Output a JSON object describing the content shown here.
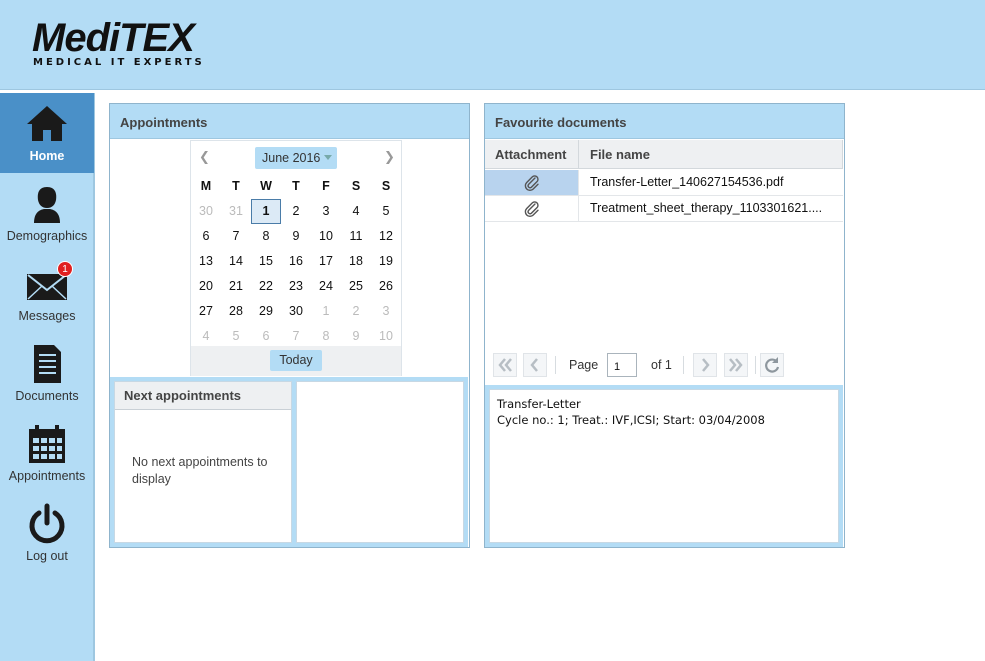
{
  "logo": {
    "main_prefix": "Med",
    "main_it": "iTEX",
    "subtitle": "MEDICAL IT EXPERTS"
  },
  "sidebar": {
    "items": [
      {
        "label": "Home",
        "icon": "home-icon",
        "active": true
      },
      {
        "label": "Demographics",
        "icon": "person-icon"
      },
      {
        "label": "Messages",
        "icon": "envelope-icon",
        "badge": "1"
      },
      {
        "label": "Documents",
        "icon": "document-icon"
      },
      {
        "label": "Appointments",
        "icon": "calendar-icon"
      },
      {
        "label": "Log out",
        "icon": "power-icon"
      }
    ]
  },
  "appointments": {
    "title": "Appointments",
    "calendar": {
      "month_label": "June 2016",
      "prev": "❮",
      "next": "❯",
      "weekdays": [
        "M",
        "T",
        "W",
        "T",
        "F",
        "S",
        "S"
      ],
      "weeks": [
        [
          {
            "d": "30",
            "o": true
          },
          {
            "d": "31",
            "o": true
          },
          {
            "d": "1",
            "s": true
          },
          {
            "d": "2"
          },
          {
            "d": "3"
          },
          {
            "d": "4"
          },
          {
            "d": "5"
          }
        ],
        [
          {
            "d": "6"
          },
          {
            "d": "7"
          },
          {
            "d": "8"
          },
          {
            "d": "9"
          },
          {
            "d": "10"
          },
          {
            "d": "11"
          },
          {
            "d": "12"
          }
        ],
        [
          {
            "d": "13"
          },
          {
            "d": "14"
          },
          {
            "d": "15"
          },
          {
            "d": "16"
          },
          {
            "d": "17"
          },
          {
            "d": "18"
          },
          {
            "d": "19"
          }
        ],
        [
          {
            "d": "20"
          },
          {
            "d": "21"
          },
          {
            "d": "22"
          },
          {
            "d": "23"
          },
          {
            "d": "24"
          },
          {
            "d": "25"
          },
          {
            "d": "26"
          }
        ],
        [
          {
            "d": "27"
          },
          {
            "d": "28"
          },
          {
            "d": "29"
          },
          {
            "d": "30"
          },
          {
            "d": "1",
            "o": true
          },
          {
            "d": "2",
            "o": true
          },
          {
            "d": "3",
            "o": true
          }
        ],
        [
          {
            "d": "4",
            "o": true
          },
          {
            "d": "5",
            "o": true
          },
          {
            "d": "6",
            "o": true
          },
          {
            "d": "7",
            "o": true
          },
          {
            "d": "8",
            "o": true
          },
          {
            "d": "9",
            "o": true
          },
          {
            "d": "10",
            "o": true
          }
        ]
      ],
      "today_label": "Today"
    },
    "next": {
      "title": "Next appointments",
      "empty_text": "No next appointments to display"
    }
  },
  "favourites": {
    "title": "Favourite documents",
    "columns": {
      "attachment": "Attachment",
      "file_name": "File name"
    },
    "rows": [
      {
        "file_name": "Transfer-Letter_140627154536.pdf",
        "selected": true
      },
      {
        "file_name": "Treatment_sheet_therapy_1103301621...."
      }
    ],
    "pager": {
      "page_label": "Page",
      "page_value": "1",
      "of_label": "of 1"
    },
    "detail": {
      "line1": "Transfer-Letter",
      "line2": "Cycle no.: 1; Treat.: IVF,ICSI; Start: 03/04/2008"
    }
  },
  "colors": {
    "header_bg": "#b3dcf5",
    "active_nav": "#4a90c8",
    "badge": "#e02020"
  }
}
